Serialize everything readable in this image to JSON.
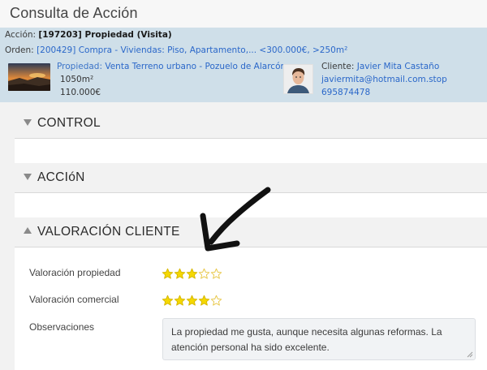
{
  "page": {
    "title": "Consulta de Acción"
  },
  "accion": {
    "label": "Acción:",
    "value": "[197203] Propiedad (Visita)"
  },
  "orden": {
    "label": "Orden:",
    "code": "[200429]",
    "text": "Compra - Viviendas: Piso, Apartamento,... <300.000€, >250m²"
  },
  "propiedad": {
    "label": "Propiedad:",
    "name": "Venta Terreno urbano - Pozuelo de Alarcón",
    "area": "1050m²",
    "price": "110.000€"
  },
  "cliente": {
    "label": "Cliente:",
    "name": "Javier Mita Castaño",
    "email": "javiermita@hotmail.com.stop",
    "phone": "695874478"
  },
  "sections": [
    {
      "title": "CONTROL",
      "state": "collapsed"
    },
    {
      "title": "ACCIóN",
      "state": "collapsed"
    },
    {
      "title": "VALORACIÓN CLIENTE",
      "state": "expanded"
    }
  ],
  "valoracion": {
    "propiedad": {
      "label": "Valoración propiedad",
      "rating": 3,
      "max": 5
    },
    "comercial": {
      "label": "Valoración comercial",
      "rating": 4,
      "max": 5
    },
    "observaciones": {
      "label": "Observaciones",
      "value": "La propiedad me gusta, aunque necesita algunas reformas. La atención personal ha sido excelente."
    }
  },
  "colors": {
    "info_bg": "#cfdfe9",
    "link": "#2a67c9",
    "star_fill": "#f5d800",
    "star_outline": "#d6b800"
  }
}
